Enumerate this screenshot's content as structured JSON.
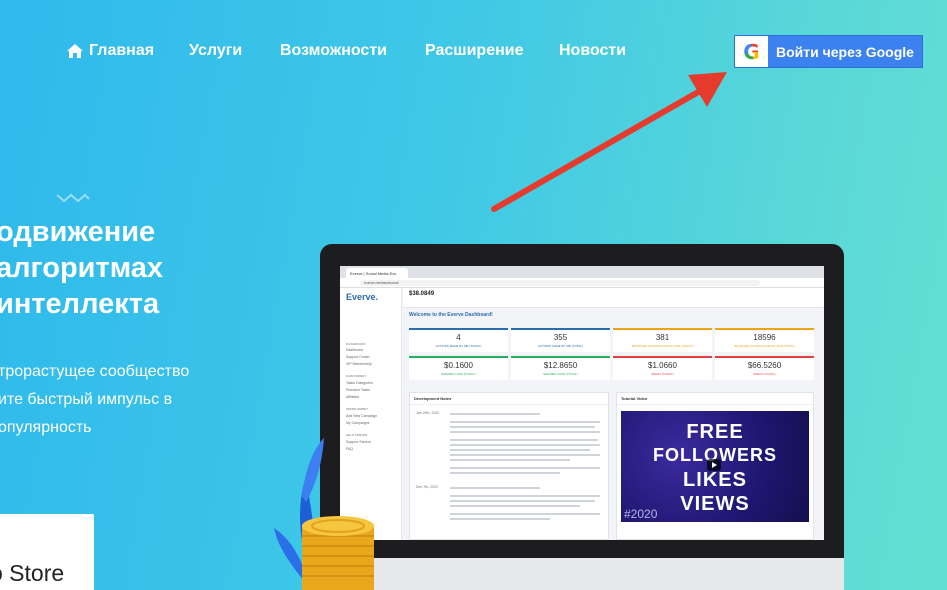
{
  "nav": {
    "items": [
      "Главная",
      "Услуги",
      "Возможности",
      "Расширение",
      "Новости"
    ],
    "home_icon": "home-icon",
    "login_label": "Войти через Google",
    "login_icon": "google-icon"
  },
  "hero": {
    "title_lines": [
      "одвижение",
      "алгоритмах",
      "интеллекта"
    ],
    "desc_lines": [
      "трорастущее сообщество",
      "ите быстрый импульс в",
      "опулярность"
    ],
    "store_label": "o Store"
  },
  "screen": {
    "tab_title": "Everve | Social Media Exc",
    "address": "everve.net/dashboard/",
    "balance": "$38.0849",
    "logo": "Everve.",
    "sidebar_heads": [
      "DASHBOARD",
      "EARN MONEY",
      "SPEND MONEY",
      "HELP CENTER"
    ],
    "sidebar_items": [
      "Dashboard",
      "Support Center",
      "VIP Membership",
      "Tasks Categories",
      "Premium Tasks",
      "Affiliates",
      "Add New Campaign",
      "My Campaigns",
      "Support Service",
      "FAQ"
    ],
    "welcome": "Welcome to the Everve Dashboard!",
    "cards": [
      {
        "value": "4",
        "label": "ACTIONS MADE BY ME (TODAY)",
        "color": "#2b6cb0"
      },
      {
        "value": "355",
        "label": "ACTIONS MADE BY ME (TOTAL)",
        "color": "#2b6cb0"
      },
      {
        "value": "381",
        "label": "RECEIVED ACTIONS FOR MY ADS (TODAY)",
        "color": "#f0a21b"
      },
      {
        "value": "18596",
        "label": "RECEIVED ACTIONS FOR MY ADS (TOTAL)",
        "color": "#f0a21b"
      },
      {
        "value": "$0.1600",
        "label": "EARNED CASH (TODAY)",
        "color": "#27ae60"
      },
      {
        "value": "$12.8650",
        "label": "EARNED CASH (TOTAL)",
        "color": "#27ae60"
      },
      {
        "value": "$1.0660",
        "label": "SPENT (TODAY)",
        "color": "#e53e3e"
      },
      {
        "value": "$66.5260",
        "label": "SPENT (TOTAL)",
        "color": "#e53e3e"
      }
    ],
    "dev_notes_title": "Development Notes",
    "dev_dates": [
      "Jan 29th, 2020",
      "Dec 7th, 2020"
    ],
    "tutorial_title": "Tutorial Video",
    "video_lines": [
      "FREE",
      "FOLLOWERS",
      "LIKES",
      "VIEWS"
    ],
    "video_tag": "#2020"
  },
  "colors": {
    "login_button": "#3b82f0",
    "arrow": "#e53b2c"
  }
}
